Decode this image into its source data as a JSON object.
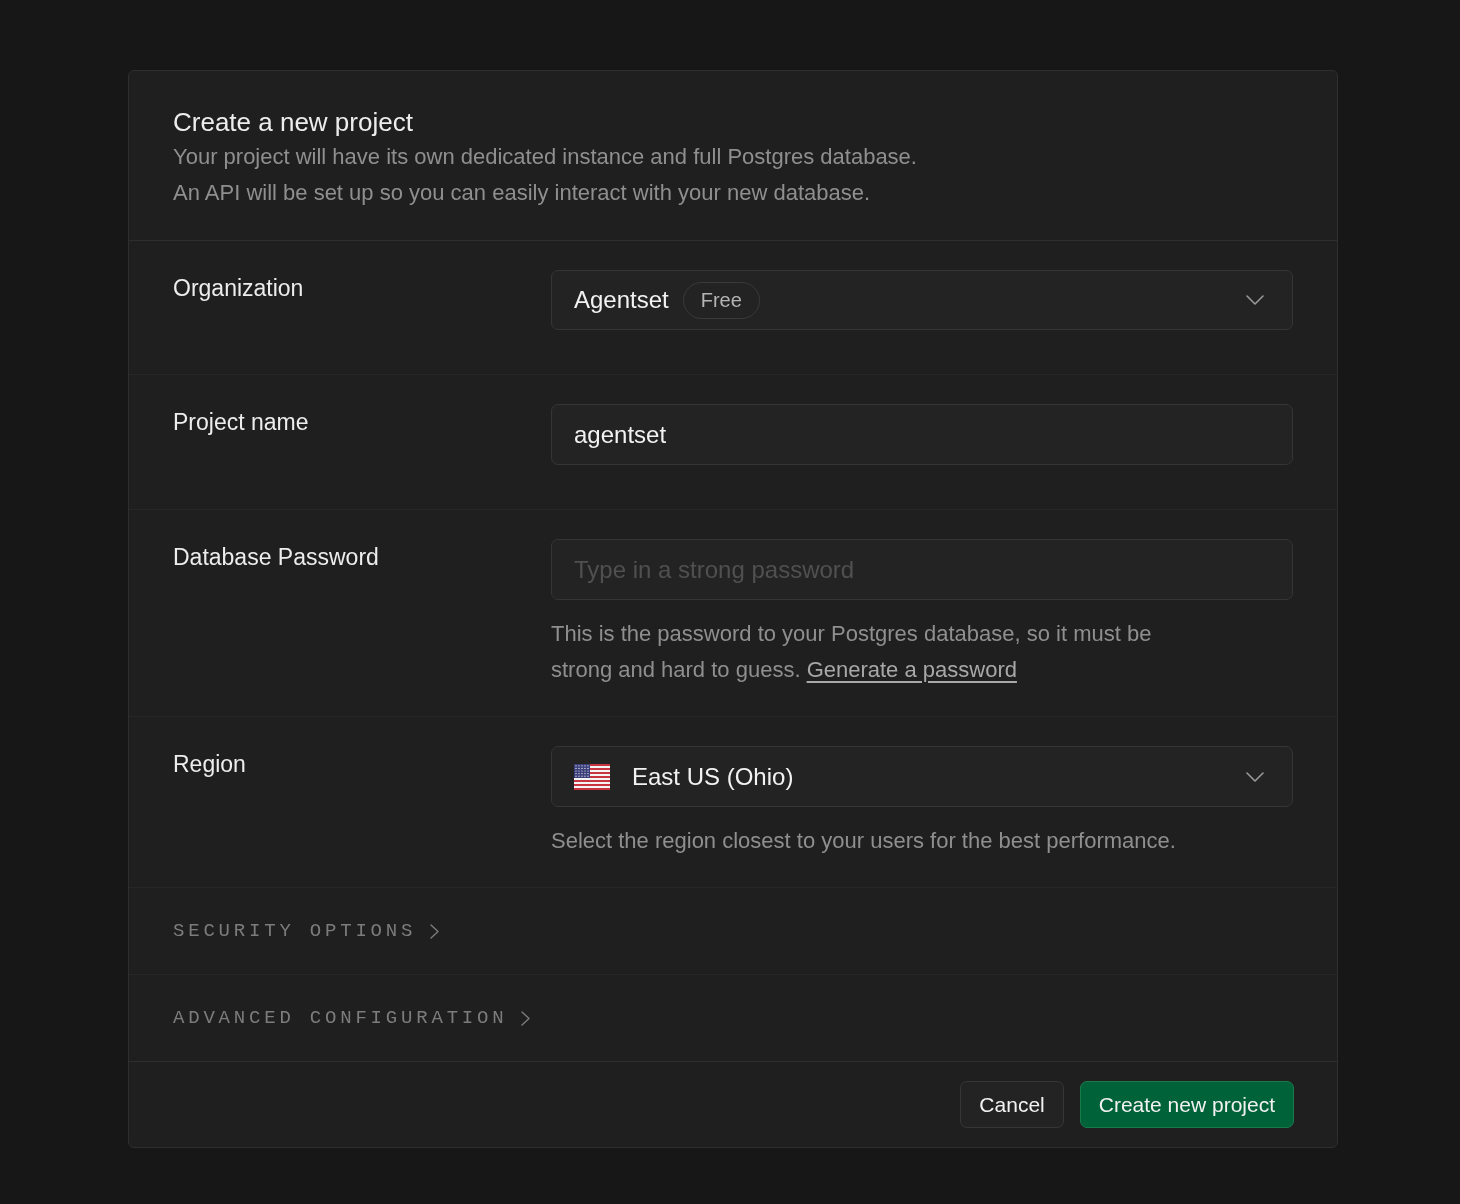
{
  "dialog": {
    "title": "Create a new project",
    "description": [
      "Your project will have its own dedicated instance and full Postgres database.",
      "An API will be set up so you can easily interact with your new database."
    ]
  },
  "fields": [
    {
      "kind": "select",
      "label": "Organization",
      "value": "Agentset",
      "badge": "Free"
    },
    {
      "kind": "text",
      "label": "Project name",
      "value": "agentset"
    },
    {
      "kind": "password",
      "label": "Database Password",
      "placeholder": "Type in a strong password",
      "help": "This is the password to your Postgres database, so it must be strong and hard to guess.",
      "help_link": "Generate a password"
    },
    {
      "kind": "region",
      "label": "Region",
      "value": "East US (Ohio)",
      "help": "Select the region closest to your users for the best performance."
    }
  ],
  "sections": [
    {
      "label": "SECURITY OPTIONS",
      "expanded": false
    },
    {
      "label": "ADVANCED CONFIGURATION",
      "expanded": false
    }
  ],
  "buttons": [
    {
      "label": "Cancel",
      "kind": "secondary"
    },
    {
      "label": "Create new project",
      "kind": "primary"
    }
  ]
}
